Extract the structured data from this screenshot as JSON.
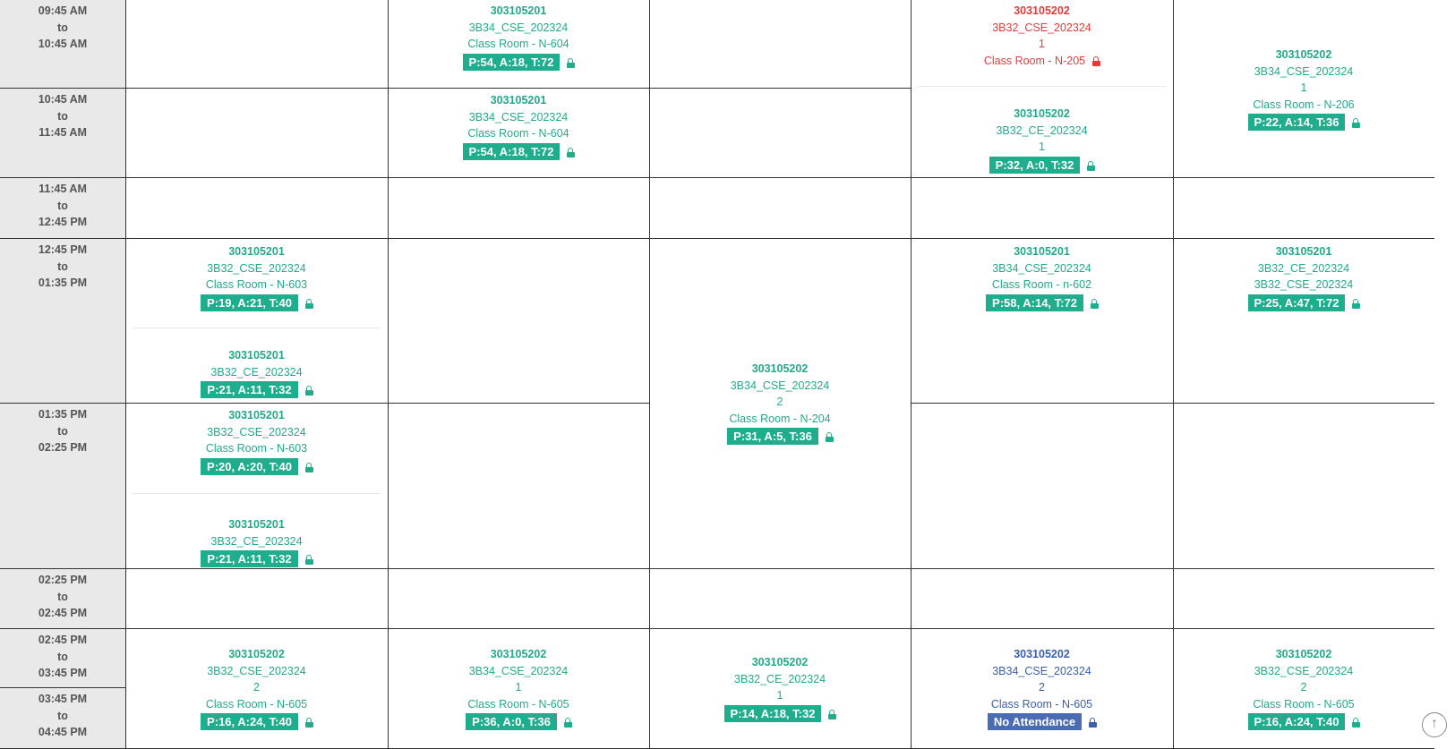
{
  "times": [
    {
      "name": "time-0945",
      "lines": [
        "09:45 AM",
        "to",
        "10:45 AM"
      ]
    },
    {
      "name": "time-1045",
      "lines": [
        "10:45 AM",
        "to",
        "11:45 AM"
      ]
    },
    {
      "name": "time-1145",
      "lines": [
        "11:45 AM",
        "to",
        "12:45 PM"
      ]
    },
    {
      "name": "time-1245",
      "lines": [
        "12:45 PM",
        "to",
        "01:35 PM"
      ]
    },
    {
      "name": "time-0135",
      "lines": [
        "01:35 PM",
        "to",
        "02:25 PM"
      ]
    },
    {
      "name": "time-0225",
      "lines": [
        "02:25 PM",
        "to",
        "02:45 PM"
      ]
    },
    {
      "name": "time-0245",
      "lines": [
        "02:45 PM",
        "to",
        "03:45 PM"
      ]
    },
    {
      "name": "time-0345",
      "lines": [
        "03:45 PM",
        "to",
        "04:45 PM"
      ]
    }
  ],
  "entries": [
    {
      "col": 1,
      "color": "green",
      "lines": [
        "303105201",
        "3B34_CSE_202324",
        "Class Room - N-604"
      ],
      "badge": "P:54, A:18, T:72"
    },
    {
      "col": 1,
      "color": "green",
      "lines": [
        "303105201",
        "3B34_CSE_202324",
        "Class Room - N-604"
      ],
      "badge": "P:54, A:18, T:72"
    },
    {
      "col": 3,
      "color": "red",
      "lines": [
        "303105202",
        "3B32_CSE_202324",
        "1",
        "Class Room - N-205"
      ],
      "badge": ""
    },
    {
      "col": 3,
      "color": "green",
      "lines": [
        "303105202",
        "3B32_CE_202324",
        "1"
      ],
      "badge": "P:32, A:0, T:32"
    },
    {
      "col": 4,
      "color": "green",
      "lines": [
        "303105202",
        "3B34_CSE_202324",
        "1",
        "Class Room - N-206"
      ],
      "badge": "P:22, A:14, T:36"
    },
    {
      "col": 0,
      "color": "green",
      "lines": [
        "303105201",
        "3B32_CSE_202324",
        "Class Room - N-603"
      ],
      "badge": "P:19, A:21, T:40"
    },
    {
      "col": 0,
      "color": "green",
      "lines": [
        "303105201",
        "3B32_CE_202324"
      ],
      "badge": "P:21, A:11, T:32"
    },
    {
      "col": 2,
      "color": "green",
      "lines": [
        "303105202",
        "3B34_CSE_202324",
        "2",
        "Class Room - N-204"
      ],
      "badge": "P:31, A:5, T:36"
    },
    {
      "col": 3,
      "color": "green",
      "lines": [
        "303105201",
        "3B34_CSE_202324",
        "Class Room - n-602"
      ],
      "badge": "P:58, A:14, T:72"
    },
    {
      "col": 4,
      "color": "green",
      "lines": [
        "303105201",
        "3B32_CE_202324",
        "3B32_CSE_202324"
      ],
      "badge": "P:25, A:47, T:72"
    },
    {
      "col": 0,
      "color": "green",
      "lines": [
        "303105201",
        "3B32_CSE_202324",
        "Class Room - N-603"
      ],
      "badge": "P:20, A:20, T:40"
    },
    {
      "col": 0,
      "color": "green",
      "lines": [
        "303105201",
        "3B32_CE_202324"
      ],
      "badge": "P:21, A:11, T:32"
    },
    {
      "col": 0,
      "color": "green",
      "lines": [
        "303105202",
        "3B32_CSE_202324",
        "2",
        "Class Room - N-605"
      ],
      "badge": "P:16, A:24, T:40"
    },
    {
      "col": 1,
      "color": "green",
      "lines": [
        "303105202",
        "3B34_CSE_202324",
        "1",
        "Class Room - N-605"
      ],
      "badge": "P:36, A:0, T:36"
    },
    {
      "col": 2,
      "color": "green",
      "lines": [
        "303105202",
        "3B32_CE_202324",
        "1"
      ],
      "badge": "P:14, A:18, T:32"
    },
    {
      "col": 3,
      "color": "blue",
      "lines": [
        "303105202",
        "3B34_CSE_202324",
        "2",
        "Class Room - N-605"
      ],
      "badge": "No Attendance"
    },
    {
      "col": 4,
      "color": "green",
      "lines": [
        "303105202",
        "3B32_CSE_202324",
        "2",
        "Class Room - N-605"
      ],
      "badge": "P:16, A:24, T:40"
    }
  ],
  "colors": {
    "accent": "#1fae8d",
    "red": "#e03c3c",
    "blue": "#4a6cb2",
    "time_bg": "#e9e9e9"
  },
  "icons": {
    "lock": "lock-icon",
    "scroll_top": "arrow-up-circle-icon"
  }
}
